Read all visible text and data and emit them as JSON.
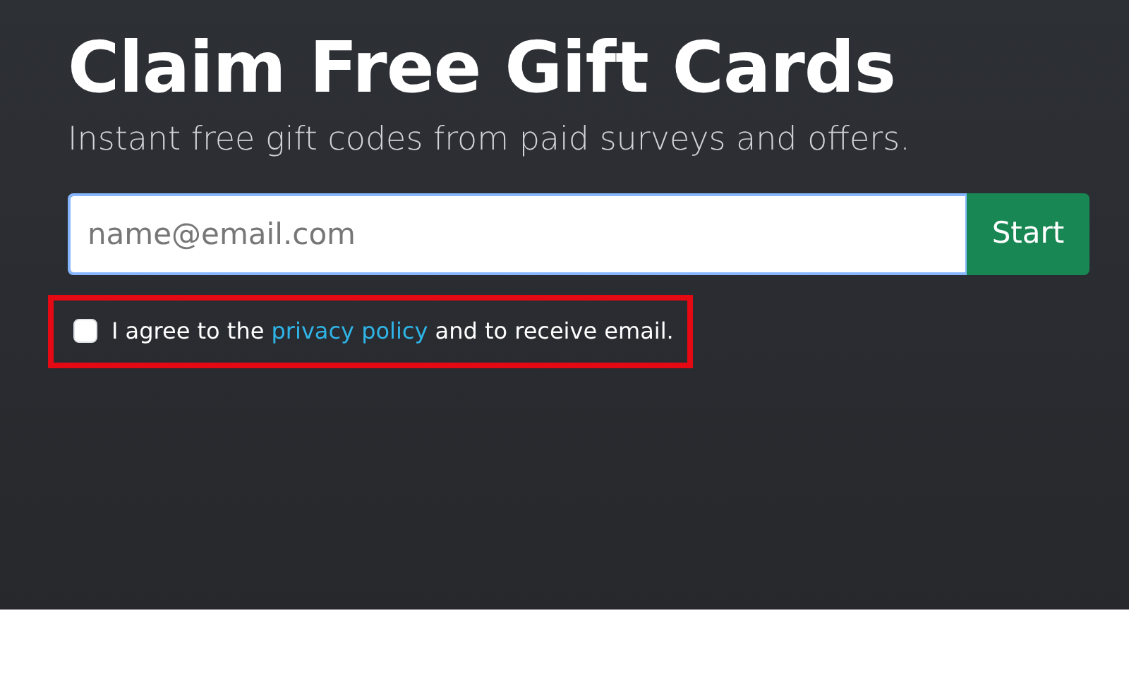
{
  "hero": {
    "title": "Claim Free Gift Cards",
    "subtitle": "Instant free gift codes from paid surveys and offers."
  },
  "signup": {
    "placeholder": "name@email.com",
    "button": "Start"
  },
  "consent": {
    "before": "I agree to the ",
    "link": "privacy policy",
    "after": " and to receive email.",
    "checked": false,
    "highlighted": true
  }
}
